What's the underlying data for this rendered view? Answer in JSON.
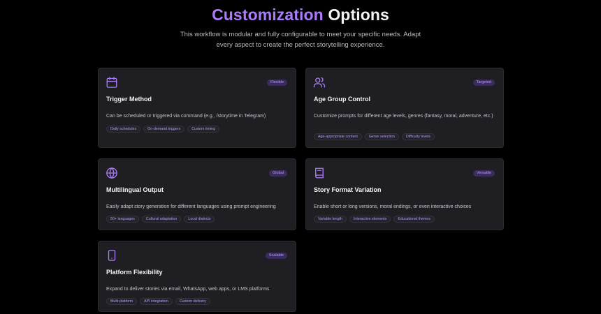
{
  "hero": {
    "title_accent": "Customization",
    "title_rest": " Options",
    "subtitle_line1": "This workflow is modular and fully configurable to meet your specific needs. Adapt",
    "subtitle_line2": "every aspect to create the perfect storytelling experience."
  },
  "colors": {
    "accent": "#a97cf8",
    "card_bg": "#1f1f23",
    "badge_bg": "#3a2c5c",
    "page_bg": "#000000"
  },
  "cards": [
    {
      "icon": "calendar-icon",
      "badge": "Flexible",
      "title": "Trigger Method",
      "description": "Can be scheduled or triggered via command (e.g., /storytime in Telegram)",
      "tags": [
        "Daily schedules",
        "On-demand triggers",
        "Custom timing"
      ]
    },
    {
      "icon": "users-icon",
      "badge": "Targeted",
      "title": "Age Group Control",
      "description": "Customize prompts for different age levels, genres (fantasy, moral, adventure, etc.)",
      "tags": [
        "Age-appropriate content",
        "Genre selection",
        "Difficulty levels"
      ]
    },
    {
      "icon": "globe-icon",
      "badge": "Global",
      "title": "Multilingual Output",
      "description": "Easily adapt story generation for different languages using prompt engineering",
      "tags": [
        "50+ languages",
        "Cultural adaptation",
        "Local dialects"
      ]
    },
    {
      "icon": "book-icon",
      "badge": "Versatile",
      "title": "Story Format Variation",
      "description": "Enable short or long versions, moral endings, or even interactive choices",
      "tags": [
        "Variable length",
        "Interactive elements",
        "Educational themes"
      ]
    },
    {
      "icon": "smartphone-icon",
      "badge": "Scalable",
      "title": "Platform Flexibility",
      "description": "Expand to deliver stories via email, WhatsApp, web apps, or LMS platforms",
      "tags": [
        "Multi-platform",
        "API integration",
        "Custom delivery"
      ]
    }
  ]
}
